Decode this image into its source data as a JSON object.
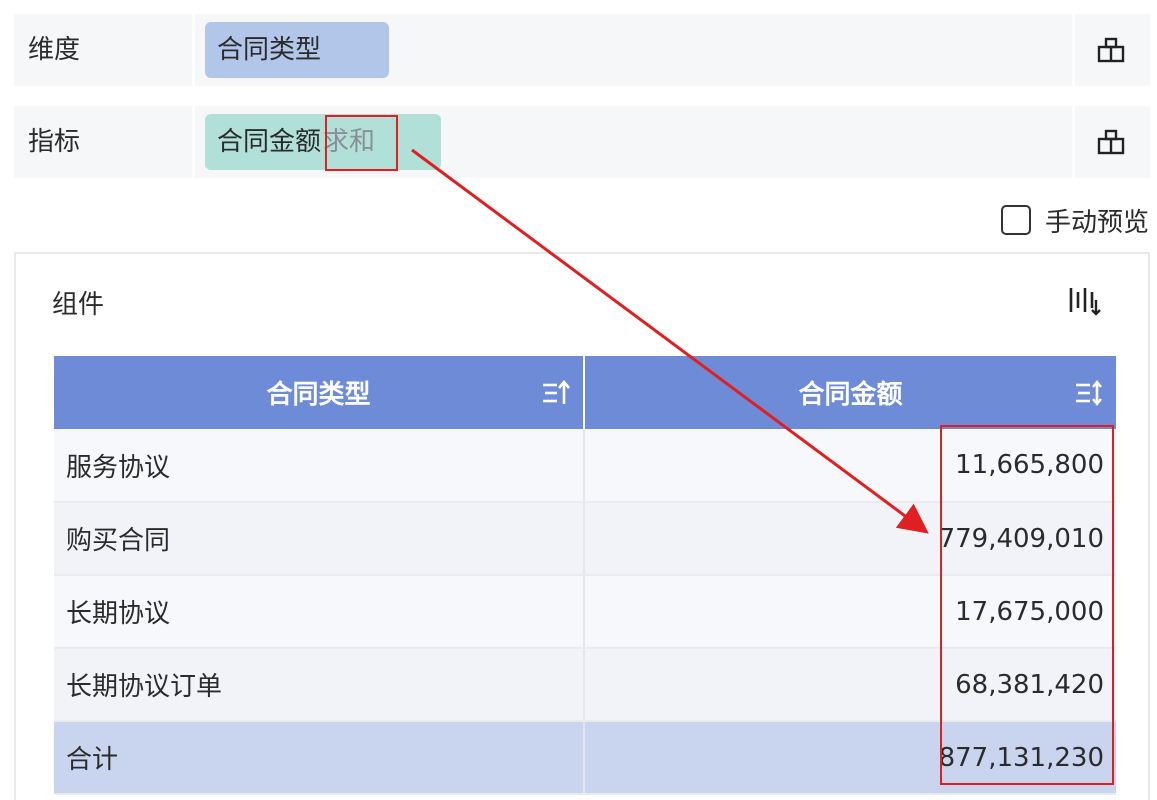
{
  "dimension": {
    "label": "维度",
    "pill": "合同类型"
  },
  "indicator": {
    "label": "指标",
    "pill_field": "合同金额",
    "pill_agg": "求和"
  },
  "manual_preview": {
    "label": "手动预览",
    "checked": false
  },
  "panel": {
    "title": "组件",
    "table": {
      "columns": [
        "合同类型",
        "合同金额"
      ],
      "rows": [
        {
          "type": "服务协议",
          "amount": "11,665,800"
        },
        {
          "type": "购买合同",
          "amount": "779,409,010"
        },
        {
          "type": "长期协议",
          "amount": "17,675,000"
        },
        {
          "type": "长期协议订单",
          "amount": "68,381,420"
        }
      ],
      "total": {
        "label": "合计",
        "amount": "877,131,230"
      }
    }
  },
  "colors": {
    "header_bg": "#6d8bd6",
    "dimension_pill": "#b1c6e8",
    "indicator_pill": "#b0e0d8",
    "total_row_bg": "#c9d4ee",
    "annotation_red": "#e02020"
  },
  "icons": {
    "field_locate": "location-frame-icon",
    "chart_switch": "chart-type-switch-icon",
    "sort_asc": "sort-ascending-icon",
    "sort_both": "sort-toggle-icon"
  }
}
